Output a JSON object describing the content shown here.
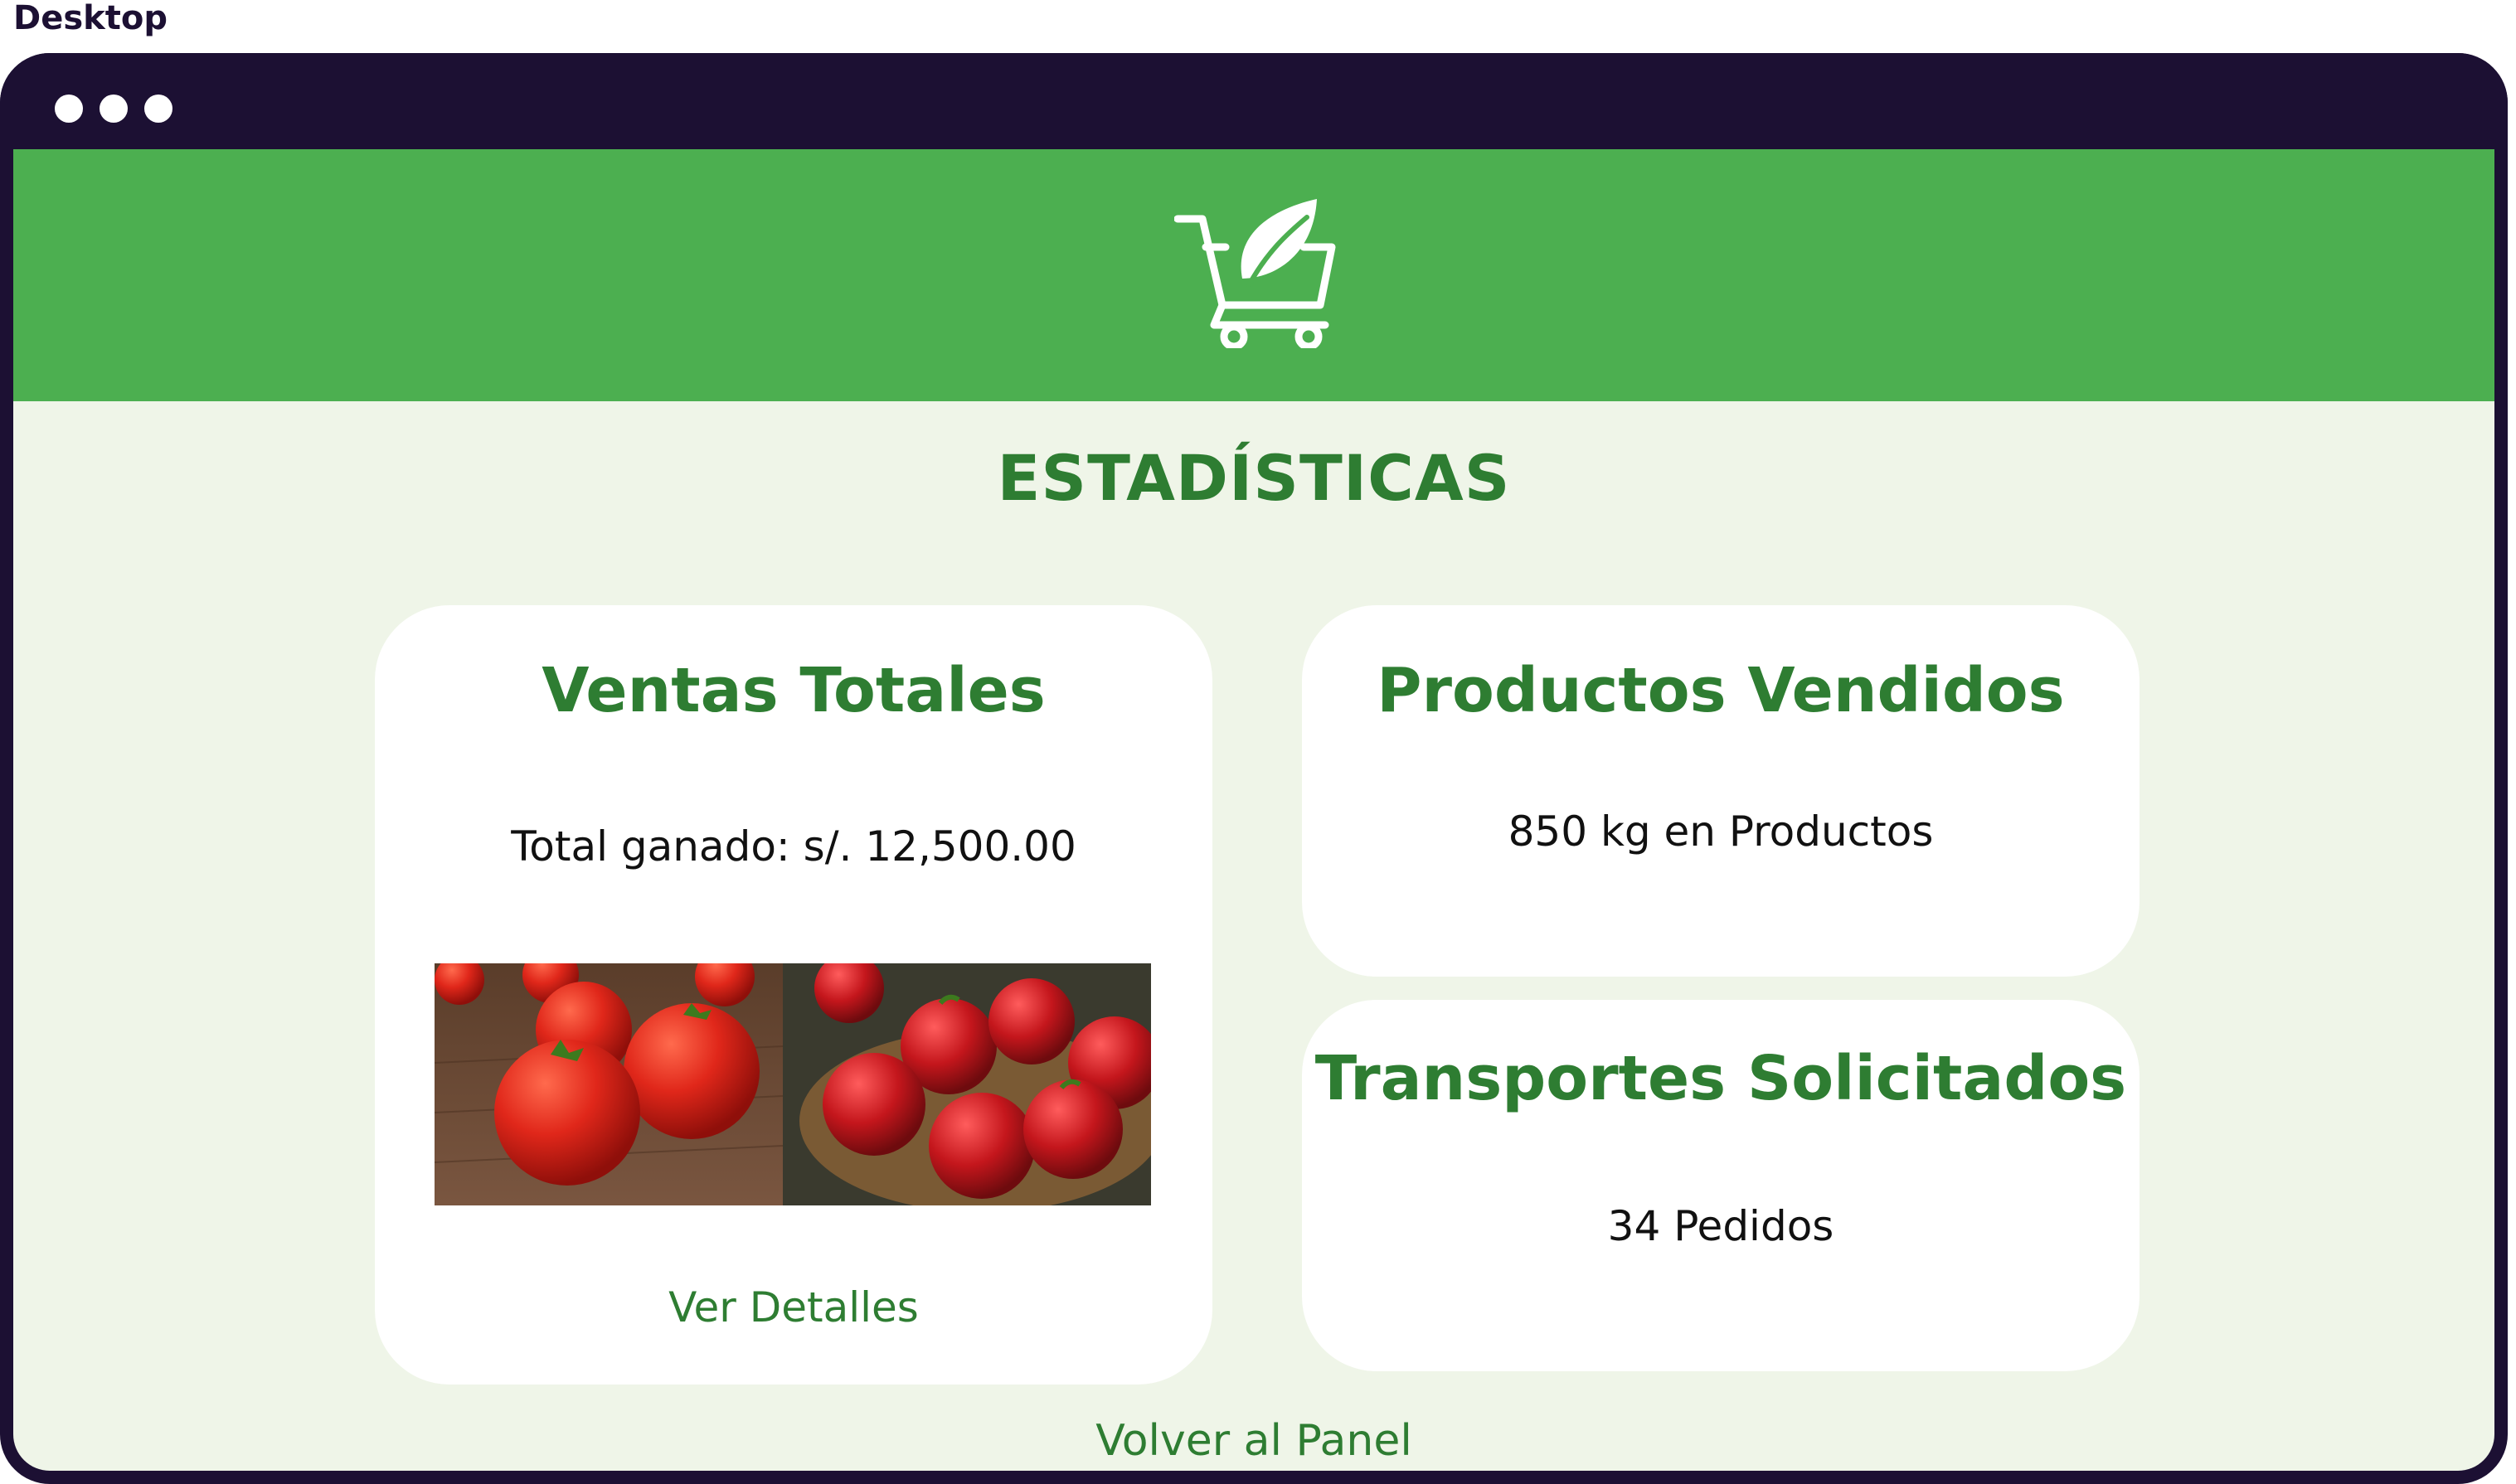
{
  "frame": {
    "label": "Desktop"
  },
  "window": {
    "controls": [
      "dot",
      "dot",
      "dot"
    ]
  },
  "header": {
    "logo_icon": "cart-leaf-icon",
    "background": "#4caf50"
  },
  "page": {
    "title": "ESTADÍSTICAS"
  },
  "cards": {
    "sales": {
      "title": "Ventas Totales",
      "text": "Total ganado: s/. 12,500.00",
      "images": [
        "tomatoes-photo",
        "apples-photo"
      ],
      "link": "Ver Detalles"
    },
    "products": {
      "title": "Productos Vendidos",
      "text": "850 kg en Productos"
    },
    "transport": {
      "title": "Transportes Solicitados",
      "text": "34 Pedidos"
    }
  },
  "footer": {
    "back_link": "Volver al Panel"
  },
  "colors": {
    "accent": "#2e7d32",
    "banner": "#4caf50",
    "page_bg": "#eff5e8",
    "frame": "#1c1033"
  }
}
